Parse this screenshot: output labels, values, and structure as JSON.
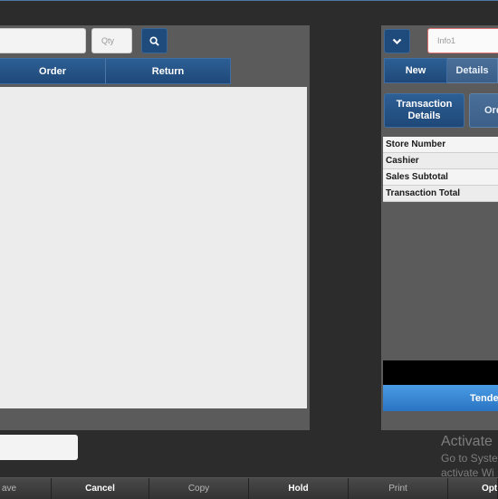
{
  "left_panel": {
    "item_input": {
      "value": "",
      "placeholder": ""
    },
    "qty_input": {
      "placeholder": "Qty"
    },
    "search_icon": "search-icon",
    "tabs": [
      {
        "label": "Order"
      },
      {
        "label": "Return"
      }
    ]
  },
  "right_panel": {
    "dropdown_icon": "chevron-down-icon",
    "info_input": {
      "placeholder": "Info1"
    },
    "segments": [
      {
        "label": "New"
      },
      {
        "label": "Details"
      }
    ],
    "transaction_details_button": "Transaction Details",
    "orders_button": "Ord",
    "details_rows": [
      {
        "label": "Store Number"
      },
      {
        "label": "Cashier"
      },
      {
        "label": "Sales Subtotal"
      },
      {
        "label": "Transaction Total"
      }
    ],
    "tender_button": "Tender"
  },
  "watermark": {
    "title": "Activate",
    "line1": "Go to Syste",
    "line2": "activate Wi"
  },
  "toolbar": {
    "buttons": [
      {
        "label": "ave"
      },
      {
        "label": "Cancel"
      },
      {
        "label": "Copy"
      },
      {
        "label": "Hold"
      },
      {
        "label": "Print"
      },
      {
        "label": "Opt"
      }
    ]
  },
  "colors": {
    "primary_blue": "#1e4b7c",
    "tender_blue": "#2a74c2",
    "background": "#2c2c2c",
    "panel": "#5b5b5b"
  }
}
